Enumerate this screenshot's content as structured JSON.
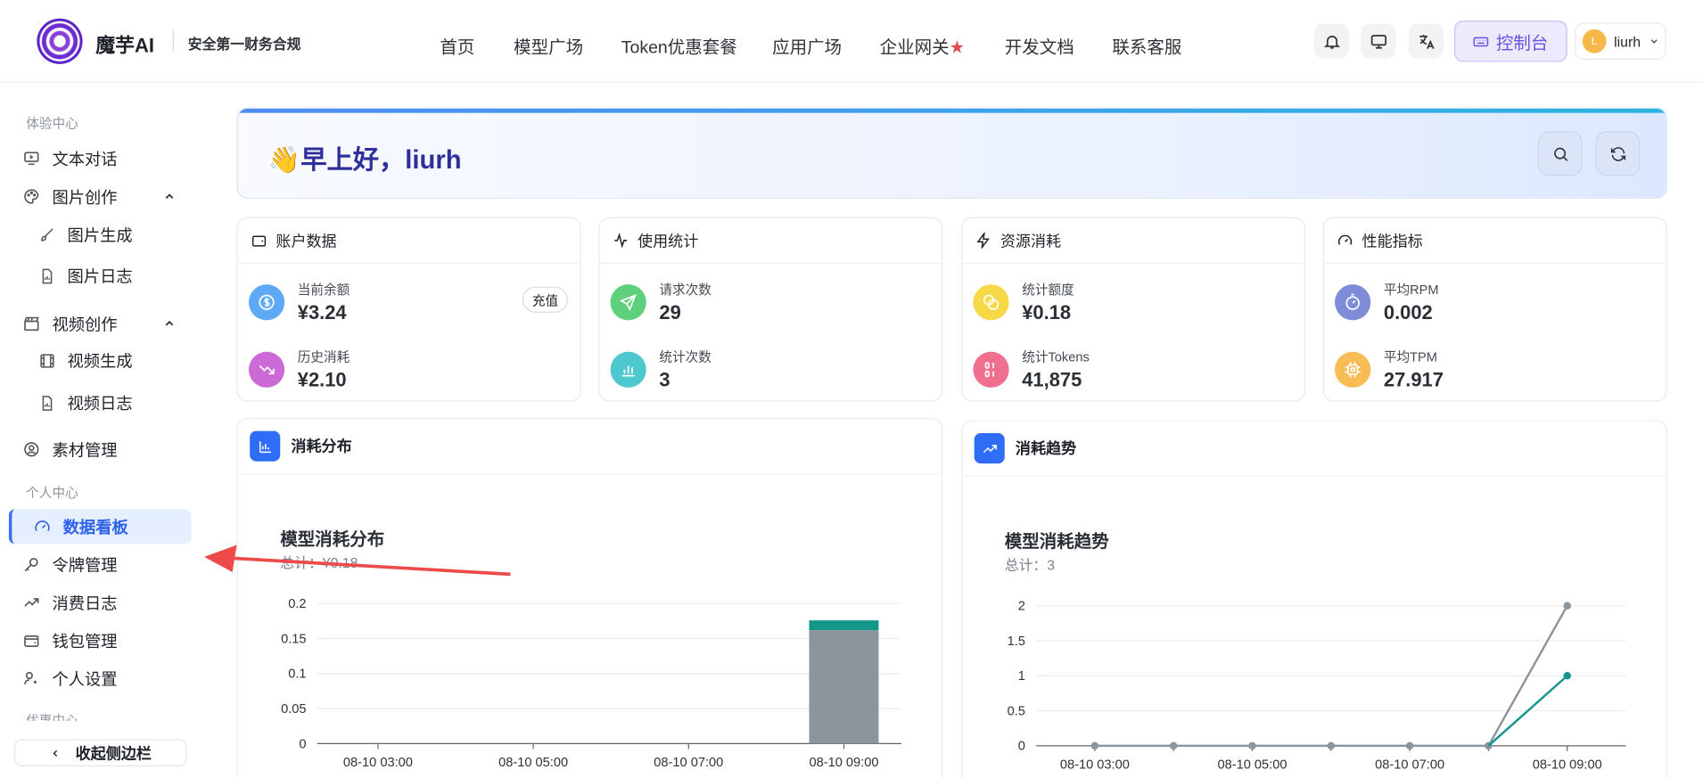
{
  "header": {
    "brand": "魔芋AI",
    "slogan": "安全第一财务合规",
    "nav": [
      "首页",
      "模型广场",
      "Token优惠套餐",
      "应用广场",
      "企业网关",
      "开发文档",
      "联系客服"
    ],
    "nav_star": "★",
    "console": "控制台",
    "user": "liurh",
    "user_initial": "L"
  },
  "sidebar": {
    "sec1": "体验中心",
    "items1": [
      "文本对话",
      "图片创作",
      "图片生成",
      "图片日志",
      "视频创作",
      "视频生成",
      "视频日志",
      "素材管理"
    ],
    "sec2": "个人中心",
    "items2": [
      "数据看板",
      "令牌管理",
      "消费日志",
      "钱包管理",
      "个人设置"
    ],
    "sec3": "优惠中心",
    "collapse": "收起侧边栏"
  },
  "greeting": {
    "text": "早上好，liurh"
  },
  "cards": [
    {
      "title": "账户数据",
      "stats": [
        {
          "label": "当前余额",
          "value": "¥3.24"
        },
        {
          "label": "历史消耗",
          "value": "¥2.10"
        }
      ],
      "action": "充值"
    },
    {
      "title": "使用统计",
      "stats": [
        {
          "label": "请求次数",
          "value": "29"
        },
        {
          "label": "统计次数",
          "value": "3"
        }
      ]
    },
    {
      "title": "资源消耗",
      "stats": [
        {
          "label": "统计额度",
          "value": "¥0.18"
        },
        {
          "label": "统计Tokens",
          "value": "41,875"
        }
      ]
    },
    {
      "title": "性能指标",
      "stats": [
        {
          "label": "平均RPM",
          "value": "0.002"
        },
        {
          "label": "平均TPM",
          "value": "27.917"
        }
      ]
    }
  ],
  "panels": [
    {
      "title": "消耗分布"
    },
    {
      "title": "消耗趋势"
    }
  ],
  "colors": {
    "accent": "#3b6ff5",
    "teal": "#15968a",
    "gray": "#8b959e"
  },
  "chart_data": [
    {
      "type": "bar",
      "title": "模型消耗分布",
      "subtitle": "总计：¥0.18",
      "categories": [
        "08-10 03:00",
        "08-10 05:00",
        "08-10 07:00",
        "08-10 09:00"
      ],
      "ylim": [
        0,
        0.2
      ],
      "yticks": [
        "0",
        "0.05",
        "0.1",
        "0.15",
        "0.2"
      ],
      "series": [
        {
          "values": [
            0,
            0,
            0,
            0.162
          ],
          "color": "#8b959e"
        },
        {
          "values": [
            0,
            0,
            0,
            0.014
          ],
          "color": "#15968a"
        }
      ]
    },
    {
      "type": "line",
      "title": "模型消耗趋势",
      "subtitle": "总计：3",
      "categories": [
        "08-10 03:00",
        "",
        "08-10 05:00",
        "",
        "08-10 07:00",
        "",
        "08-10 09:00"
      ],
      "ylim": [
        0,
        2
      ],
      "yticks": [
        "0",
        "0.5",
        "1",
        "1.5",
        "2"
      ],
      "series": [
        {
          "values": [
            0,
            0,
            0,
            0,
            0,
            0,
            2
          ],
          "color": "#8b959e"
        },
        {
          "values": [
            null,
            null,
            null,
            null,
            null,
            0,
            1
          ],
          "color": "#15968a"
        }
      ]
    }
  ]
}
